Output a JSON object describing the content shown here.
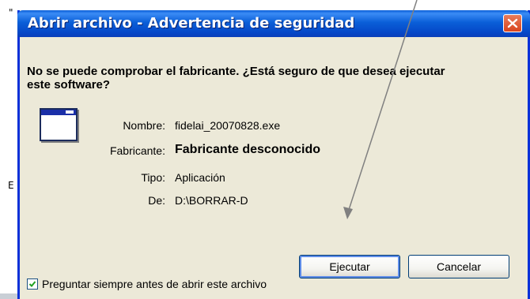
{
  "background": {
    "mark_top": "\"",
    "mark_mid": "E"
  },
  "dialog": {
    "title": "Abrir archivo - Advertencia de seguridad",
    "question": "No se puede comprobar el fabricante. ¿Está seguro de que desea ejecutar este software?",
    "fields": {
      "name_label": "Nombre:",
      "name_value": "fidelai_20070828.exe",
      "publisher_label": "Fabricante:",
      "publisher_value": "Fabricante desconocido",
      "type_label": "Tipo:",
      "type_value": "Aplicación",
      "from_label": "De:",
      "from_value": "D:\\BORRAR-D"
    },
    "run_button": "Ejecutar",
    "cancel_button": "Cancelar",
    "checkbox_label": "Preguntar siempre antes de abrir este archivo",
    "checkbox_checked": true
  },
  "colors": {
    "title_bar": "#0a5fd8",
    "close_button": "#d9451e",
    "dialog_bg": "#ece9d8",
    "annotation_arrow": "#808080"
  },
  "icons": {
    "close": "close-x-icon",
    "app": "application-window-icon",
    "checkbox": "checkmark-icon"
  }
}
